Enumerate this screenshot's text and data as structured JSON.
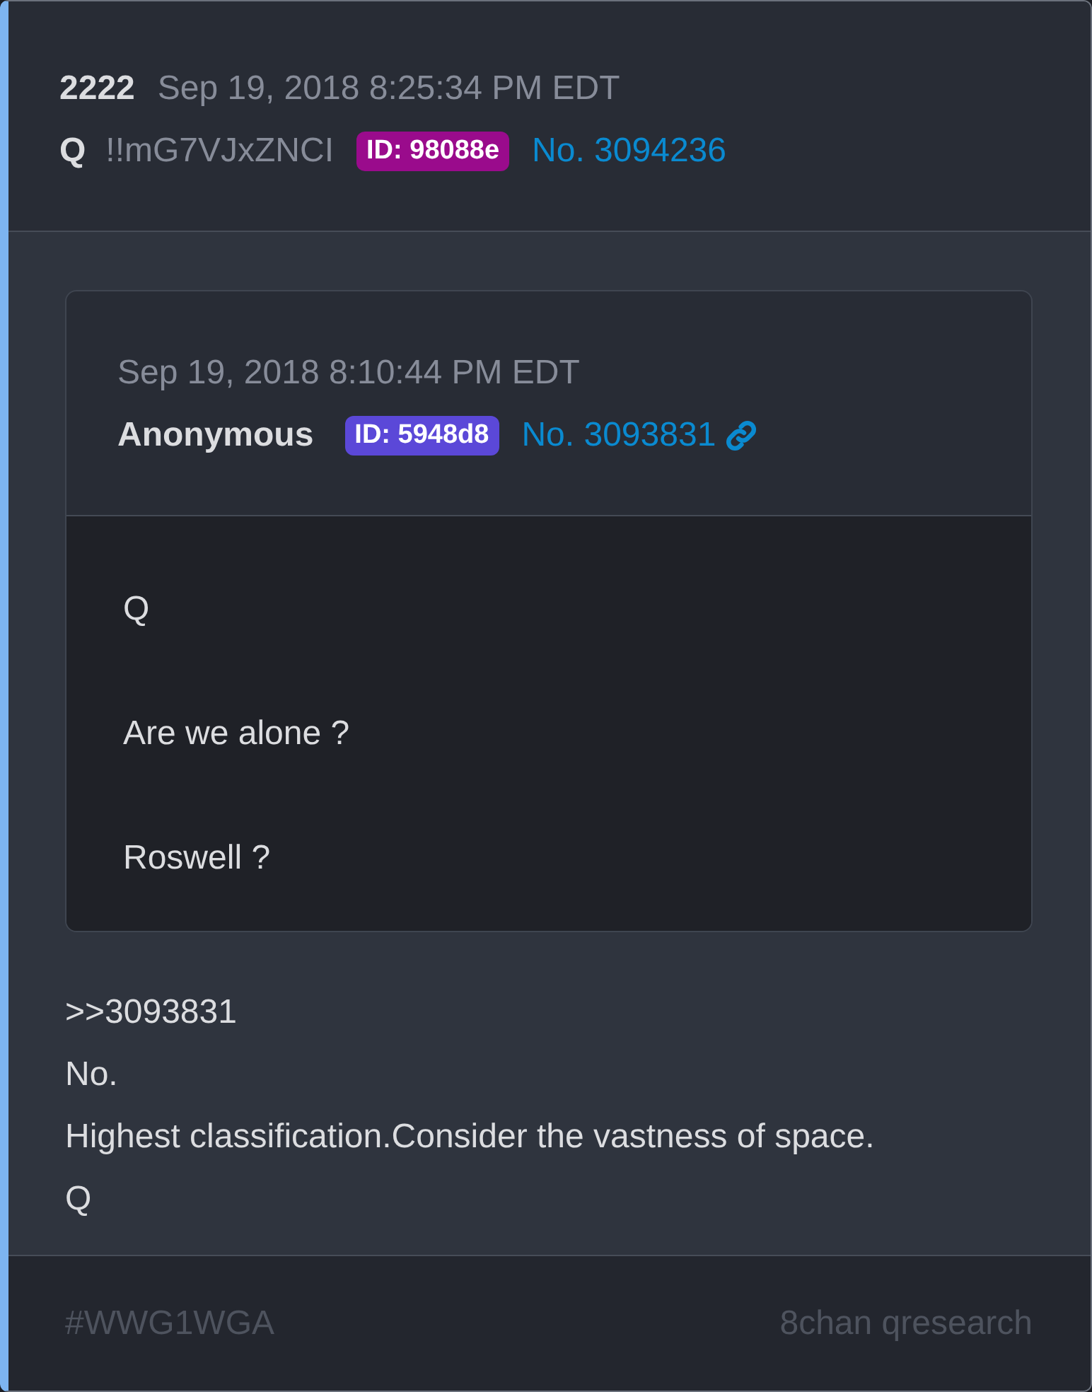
{
  "post": {
    "title": "2222",
    "date": "Sep 19, 2018 8:25:34 PM EDT",
    "name": "Q",
    "tripcode": "!!mG7VJxZNCI",
    "id_badge": {
      "text": "ID: 98088e",
      "color": "#9a0b8c"
    },
    "post_number": "No. 3094236",
    "quote": {
      "date": "Sep 19, 2018 8:10:44 PM EDT",
      "name": "Anonymous",
      "id_badge": {
        "text": "ID: 5948d8",
        "color": "#5b48d8"
      },
      "post_number": "No. 3093831",
      "paragraphs": [
        "Q",
        "Are we alone ?",
        "Roswell ?"
      ]
    },
    "body_lines": [
      ">>3093831",
      "No.",
      "Highest classification.Consider the vastness of space.",
      "Q"
    ],
    "footer": {
      "hashtag": "#WWG1WGA",
      "source": "8chan qresearch"
    }
  }
}
